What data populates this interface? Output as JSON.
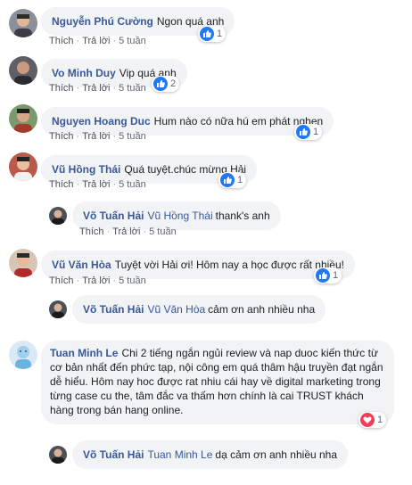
{
  "actions": {
    "like": "Thích",
    "reply": "Trả lời"
  },
  "comments": [
    {
      "author": "Nguyễn Phú Cường",
      "text": "Ngon quá anh",
      "time": "5 tuần",
      "reaction_count": "1",
      "reaction": "like"
    },
    {
      "author": "Vo Minh Duy",
      "text": "Vip quá anh",
      "time": "5 tuần",
      "reaction_count": "2",
      "reaction": "like"
    },
    {
      "author": "Nguyen Hoang Duc",
      "text": "Hum nào có nữa hú em phát nghen",
      "time": "5 tuần",
      "reaction_count": "1",
      "reaction": "like"
    },
    {
      "author": "Vũ Hồng Thái",
      "text": "Quá tuyệt.chúc mừng Hải",
      "time": "5 tuần",
      "reaction_count": "1",
      "reaction": "like",
      "reply": {
        "author": "Võ Tuấn Hải",
        "tag": "Vũ Hồng Thái",
        "text": "thank's anh",
        "time": "5 tuần"
      }
    },
    {
      "author": "Vũ Văn Hòa",
      "text": "Tuyệt vời Hải ơi! Hôm nay a học được rất nhiều!",
      "time": "5 tuần",
      "reaction_count": "1",
      "reaction": "like",
      "reply": {
        "author": "Võ Tuấn Hải",
        "tag": "Vũ Văn Hòa",
        "text": "cảm ơn anh nhiều nha",
        "time": "5 tuần"
      }
    },
    {
      "author": "Tuan Minh Le",
      "text_lines": [
        "Chi 2 tiếng ngắn ngủi review và nap duoc kiến thức từ",
        "cơ bản nhất đến phức tạp, nội công em quá thâm hậu truyền đạt ngắn",
        "dễ hiểu. Hôm nay hoc được rat nhiu cái hay về digital marketing trong",
        "từng case cu the, tâm đắc va thấm hơn chính là cai TRUST khách",
        "hàng trong bán hang online."
      ],
      "time": "5 tuần",
      "reaction_count": "1",
      "reaction": "love",
      "reply": {
        "author": "Võ Tuấn Hải",
        "tag": "Tuan Minh Le",
        "text": "dạ cảm ơn anh nhiều nha"
      }
    }
  ],
  "colors": {
    "link": "#385898",
    "bubble": "#f2f3f5",
    "like": "#2078f4",
    "love": "#f33e58"
  }
}
